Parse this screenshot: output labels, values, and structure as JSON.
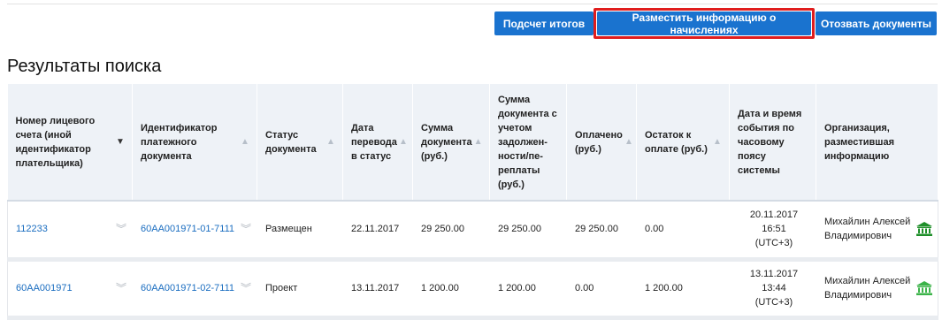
{
  "toolbar": {
    "totals_label": "Подсчет итогов",
    "place_label": "Разместить информацию о начислениях",
    "recall_label": "Отозвать документы"
  },
  "page_title": "Результаты поиска",
  "columns": [
    {
      "label": "Номер лицевого счета (иной идентификатор плательщика)",
      "sort": "sorted-desc"
    },
    {
      "label": "Идентификатор платежного документа",
      "sort": "sortable"
    },
    {
      "label": "Статус документа",
      "sort": "sortable"
    },
    {
      "label": "Дата перевода в статус",
      "sort": "sortable"
    },
    {
      "label": "Сумма документа (руб.)",
      "sort": "sortable"
    },
    {
      "label": "Сумма документа с учетом задолжен-ности/пе-реплаты (руб.)",
      "sort": "none"
    },
    {
      "label": "Оплачено (руб.)",
      "sort": "sortable"
    },
    {
      "label": "Остаток к оплате (руб.)",
      "sort": "sortable"
    },
    {
      "label": "Дата и время события по часовому поясу системы",
      "sort": "none"
    },
    {
      "label": "Организация, разместившая информацию",
      "sort": "none"
    }
  ],
  "rows": [
    {
      "account": "112233",
      "doc_id": "60АА001971-01-7111",
      "status": "Размещен",
      "status_date": "22.11.2017",
      "sum": "29 250.00",
      "sum_debt": "29 250.00",
      "paid": "29 250.00",
      "remaining": "0.00",
      "event_date": "20.11.2017",
      "event_time": "16:51",
      "event_tz": "(UTC+3)",
      "org": "Михайлин Алексей Владимирович"
    },
    {
      "account": "60АА001971",
      "doc_id": "60АА001971-02-7111",
      "status": "Проект",
      "status_date": "13.11.2017",
      "sum": "1 200.00",
      "sum_debt": "1 200.00",
      "paid": "0.00",
      "remaining": "1 200.00",
      "event_date": "13.11.2017",
      "event_time": "13:44",
      "event_tz": "(UTC+3)",
      "org": "Михайлин Алексей Владимирович"
    }
  ],
  "colors": {
    "button_bg": "#1a73cf",
    "highlight": "#e01d1d",
    "link": "#1a6dc0",
    "header_bg": "#eef2f7",
    "bank_icon_row1": "#1f8f2a",
    "bank_icon_row2": "#3cb34a"
  },
  "icons": {
    "sort": "sort-triangle-icon",
    "expand": "double-chevron-down-icon",
    "org": "bank-building-icon"
  }
}
